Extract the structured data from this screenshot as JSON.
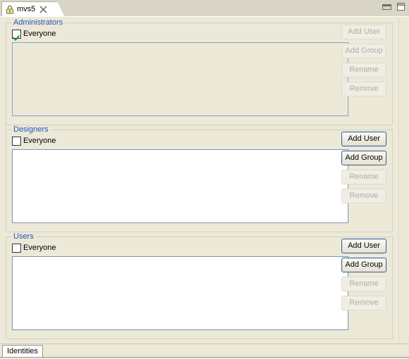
{
  "window": {
    "minimize_label": "Minimize",
    "maximize_label": "Maximize"
  },
  "editor_tab": {
    "title": "mvs5",
    "lock_icon": "lock-icon",
    "close_icon": "close-icon"
  },
  "groups": [
    {
      "title": "Administrators",
      "everyone_label": "Everyone",
      "everyone_checked": true,
      "list_enabled": false,
      "list_items": [],
      "buttons": [
        {
          "label": "Add User",
          "enabled": false
        },
        {
          "label": "Add Group",
          "enabled": false
        },
        {
          "label": "Rename",
          "enabled": false
        },
        {
          "label": "Remove",
          "enabled": false
        }
      ]
    },
    {
      "title": "Designers",
      "everyone_label": "Everyone",
      "everyone_checked": false,
      "list_enabled": true,
      "list_items": [],
      "buttons": [
        {
          "label": "Add User",
          "enabled": true
        },
        {
          "label": "Add Group",
          "enabled": true
        },
        {
          "label": "Rename",
          "enabled": false
        },
        {
          "label": "Remove",
          "enabled": false
        }
      ]
    },
    {
      "title": "Users",
      "everyone_label": "Everyone",
      "everyone_checked": false,
      "list_enabled": true,
      "list_items": [],
      "buttons": [
        {
          "label": "Add User",
          "enabled": true
        },
        {
          "label": "Add Group",
          "enabled": true
        },
        {
          "label": "Rename",
          "enabled": false
        },
        {
          "label": "Remove",
          "enabled": false
        }
      ]
    }
  ],
  "bottom_tabs": [
    {
      "label": "Identities",
      "active": true
    }
  ],
  "colors": {
    "panel_background": "#ece9d8",
    "group_title": "#2356b4",
    "list_border": "#7d93ad",
    "button_enabled_border": "#2f5b96",
    "checkmark": "#1e8a28",
    "lock_icon": "#8a7a2a"
  }
}
